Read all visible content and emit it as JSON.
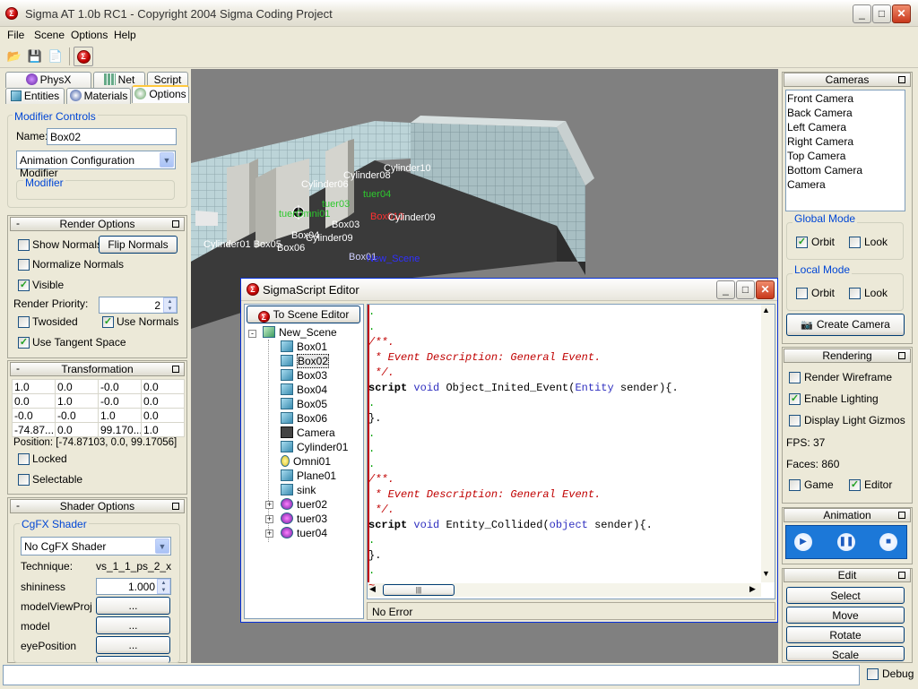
{
  "window": {
    "title": "Sigma AT 1.0b RC1 - Copyright 2004 Sigma Coding Project",
    "min": "_",
    "max": "□",
    "close": "✕"
  },
  "menu": [
    "File",
    "Scene",
    "Options",
    "Help"
  ],
  "left": {
    "tabs_row1": [
      "PhysX",
      "Net",
      "Script"
    ],
    "tabs_row2": [
      "Entities",
      "Materials",
      "Options"
    ],
    "modifier": {
      "group_label": "Modifier Controls",
      "name_label": "Name:",
      "name_value": "Box02",
      "combo_value": "Animation Configuration Modifier",
      "sub_group": "Modifier"
    },
    "render": {
      "title": "Render Options",
      "show_normals": "Show Normals",
      "flip_normals": "Flip Normals",
      "normalize": "Normalize Normals",
      "visible": "Visible",
      "priority_label": "Render Priority:",
      "priority_value": "2",
      "twosided": "Twosided",
      "use_normals": "Use Normals",
      "tangent": "Use Tangent Space"
    },
    "transform": {
      "title": "Transformation",
      "rows": [
        [
          "1.0",
          "0.0",
          "-0.0",
          "0.0"
        ],
        [
          "0.0",
          "1.0",
          "-0.0",
          "0.0"
        ],
        [
          "-0.0",
          "-0.0",
          "1.0",
          "0.0"
        ],
        [
          "-74.87...",
          "0.0",
          "99.170...",
          "1.0"
        ]
      ],
      "position": "Position: [-74.87103, 0.0, 99.17056]",
      "locked": "Locked",
      "selectable": "Selectable"
    },
    "shader": {
      "title": "Shader Options",
      "group_label": "CgFX Shader",
      "combo_value": "No CgFX Shader",
      "technique_label": "Technique:",
      "technique_value": "vs_1_1_ps_2_x",
      "shininess_label": "shininess",
      "shininess_value": "1.000",
      "params": [
        "modelViewProj",
        "model",
        "eyePosition"
      ],
      "dots": "..."
    }
  },
  "scene_labels": [
    {
      "t": "Cylinder06"
    },
    {
      "t": "Cylinder08"
    },
    {
      "t": "Cylinder10"
    },
    {
      "t": "tuer04"
    },
    {
      "t": "tuer03"
    },
    {
      "t": "tuerOmni01"
    },
    {
      "t": "Box03"
    },
    {
      "t": "Box010"
    },
    {
      "t": "Cylinder09"
    },
    {
      "t": "Box04"
    },
    {
      "t": "Cylinder09"
    },
    {
      "t": "Cylinder01 Box05"
    },
    {
      "t": "Box06"
    },
    {
      "t": "Box01"
    },
    {
      "t": "New_Scene"
    }
  ],
  "editor": {
    "title": "SigmaScript Editor",
    "to_scene": "To Scene Editor",
    "tree_root": "New_Scene",
    "tree_items": [
      "Box01",
      "Box02",
      "Box03",
      "Box04",
      "Box05",
      "Box06",
      "Camera",
      "Cylinder01",
      "Omni01",
      "Plane01",
      "sink",
      "tuer02",
      "tuer03",
      "tuer04"
    ],
    "code": [
      {
        "cls": "dot",
        "t": "."
      },
      {
        "cls": "dot",
        "t": "."
      },
      {
        "cls": "cm",
        "t": "/**."
      },
      {
        "cls": "cm",
        "t": " * Event Description: General Event."
      },
      {
        "cls": "cm",
        "t": " */."
      },
      {
        "cls": "s1",
        "t": "script void Object_Inited_Event(Entity sender){."
      },
      {
        "cls": "dot",
        "t": "."
      },
      {
        "cls": "plain",
        "t": "}."
      },
      {
        "cls": "dot",
        "t": "."
      },
      {
        "cls": "dot",
        "t": "."
      },
      {
        "cls": "dot",
        "t": "."
      },
      {
        "cls": "cm",
        "t": "/**."
      },
      {
        "cls": "cm",
        "t": " * Event Description: General Event."
      },
      {
        "cls": "cm",
        "t": " */."
      },
      {
        "cls": "s2",
        "t": "script void Entity_Collided(object sender){."
      },
      {
        "cls": "dot",
        "t": "."
      },
      {
        "cls": "plain",
        "t": "}."
      },
      {
        "cls": "dot",
        "t": "."
      },
      {
        "cls": "red",
        "t": "~"
      }
    ],
    "status": "No Error"
  },
  "right": {
    "cameras_title": "Cameras",
    "cameras": [
      "Front Camera",
      "Back Camera",
      "Left Camera",
      "Right Camera",
      "Top Camera",
      "Bottom Camera",
      "Camera"
    ],
    "global_mode": "Global Mode",
    "local_mode": "Local Mode",
    "orbit": "Orbit",
    "look": "Look",
    "create_camera": "Create Camera",
    "rendering_title": "Rendering",
    "wireframe": "Render Wireframe",
    "lighting": "Enable Lighting",
    "gizmos": "Display Light Gizmos",
    "fps": "FPS: 37",
    "faces": "Faces: 860",
    "game": "Game",
    "editor": "Editor",
    "animation_title": "Animation",
    "edit_title": "Edit",
    "edit_buttons": [
      "Select",
      "Move",
      "Rotate",
      "Scale"
    ]
  },
  "statusbar": {
    "debug": "Debug"
  }
}
